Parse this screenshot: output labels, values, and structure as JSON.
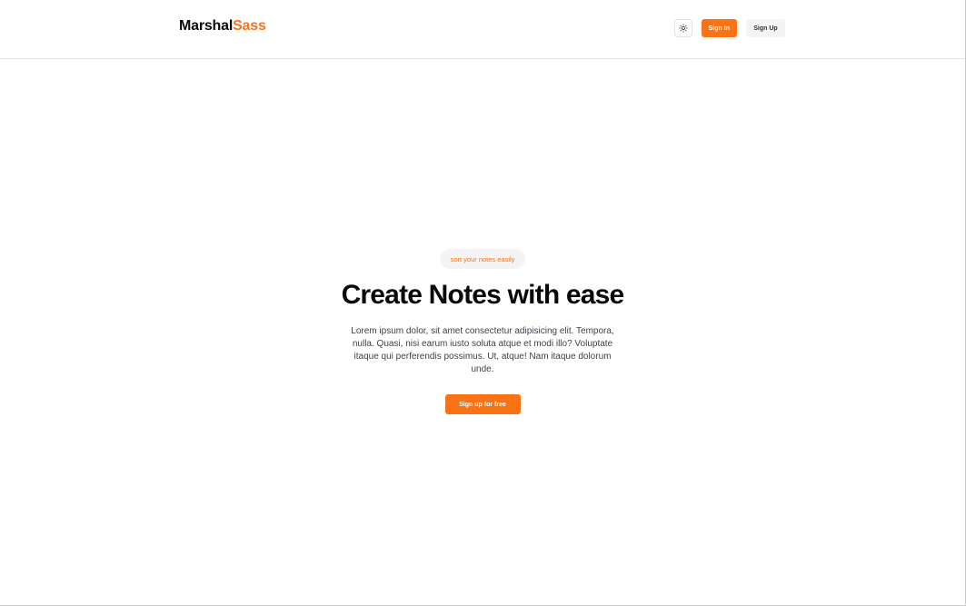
{
  "header": {
    "brand_primary": "Marshal",
    "brand_accent": "Sass",
    "theme_toggle_icon": "sun-icon",
    "sign_in_label": "Sign In",
    "sign_up_label": "Sign Up"
  },
  "hero": {
    "badge": "sort your notes easily",
    "title": "Create Notes with ease",
    "description": "Lorem ipsum dolor, sit amet consectetur adipisicing elit. Tempora, nulla. Quasi, nisi earum iusto soluta atque et modi illo? Voluptate itaque qui perferendis possimus. Ut, atque! Nam itaque dolorum unde.",
    "cta_label": "Sign up for free"
  },
  "colors": {
    "accent": "#f97316",
    "text": "#0a0a0a",
    "muted_bg": "#f4f4f5"
  }
}
